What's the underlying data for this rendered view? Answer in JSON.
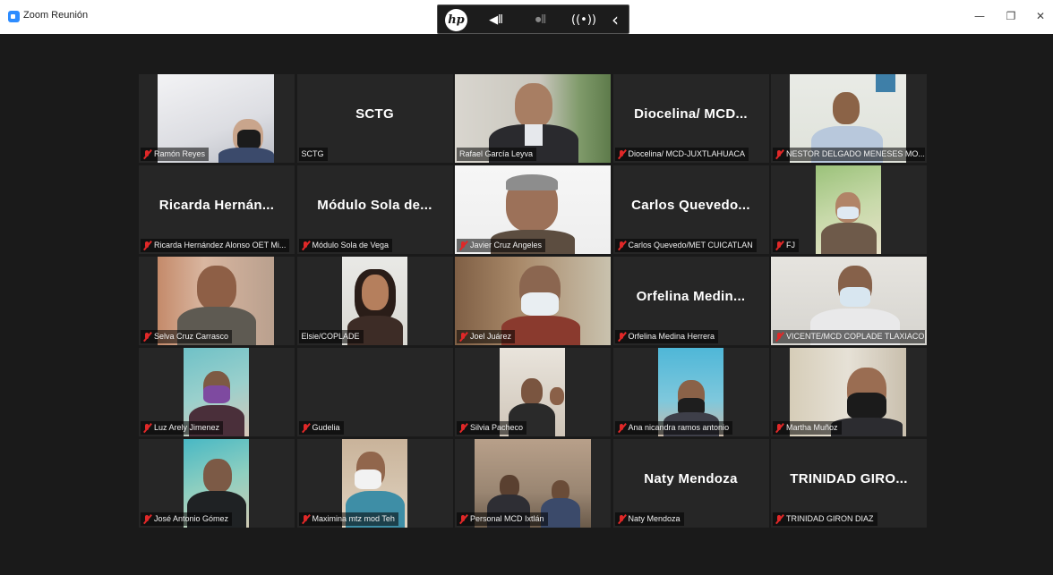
{
  "window": {
    "title": "Zoom Reunión",
    "minimize": "—",
    "restore": "❐",
    "close": "✕"
  },
  "hp_toolbar": {
    "logo": "hp",
    "speaker": "◀⦀",
    "mic": "⏺⦀",
    "broadcast": "((•))",
    "collapse": "‹"
  },
  "colors": {
    "active_speaker_border": "#a6cc3b",
    "muted_icon": "#e02828",
    "tile_bg": "#262626"
  },
  "participants": [
    {
      "label": "Ramón Reyes",
      "muted": true,
      "video": true
    },
    {
      "label": "SCTG",
      "display": "SCTG",
      "muted": false,
      "video": false
    },
    {
      "label": "Rafael García Leyva",
      "muted": false,
      "video": true,
      "active": true
    },
    {
      "label": "Diocelina/ MCD-JUXTLAHUACA",
      "display": "Diocelina/ MCD...",
      "muted": true,
      "video": false
    },
    {
      "label": "NESTOR DELGADO MENESES MO...",
      "muted": true,
      "video": true
    },
    {
      "label": "Ricarda Hernández Alonso OET Mi...",
      "display": "Ricarda Hernán...",
      "muted": true,
      "video": false
    },
    {
      "label": "Módulo Sola de Vega",
      "display": "Módulo Sola de...",
      "muted": true,
      "video": false
    },
    {
      "label": "Javier Cruz Angeles",
      "muted": true,
      "video": true
    },
    {
      "label": "Carlos Quevedo/MET CUICATLAN",
      "display": "Carlos Quevedo...",
      "muted": true,
      "video": false
    },
    {
      "label": "FJ",
      "muted": true,
      "video": true
    },
    {
      "label": "Selva Cruz Carrasco",
      "muted": true,
      "video": true
    },
    {
      "label": "Elsie/COPLADE",
      "muted": false,
      "video": true
    },
    {
      "label": "Joel Juárez",
      "muted": true,
      "video": true
    },
    {
      "label": "Orfelina Medina Herrera",
      "display": "Orfelina Medin...",
      "muted": true,
      "video": false
    },
    {
      "label": "VICENTE/MCD COPLADE TLAXIACO",
      "muted": true,
      "video": true
    },
    {
      "label": "Luz Arely Jimenez",
      "muted": true,
      "video": true
    },
    {
      "label": "Gudelia",
      "muted": true,
      "video": false
    },
    {
      "label": "Silvia Pacheco",
      "muted": true,
      "video": true
    },
    {
      "label": "Ana nicandra ramos antonio",
      "muted": true,
      "video": true
    },
    {
      "label": "Martha Muñoz",
      "muted": true,
      "video": true
    },
    {
      "label": "José Antonio Gómez",
      "muted": true,
      "video": true
    },
    {
      "label": "Maximina mtz mod Teh",
      "muted": true,
      "video": true
    },
    {
      "label": "Personal MCD Ixtlán",
      "muted": true,
      "video": true
    },
    {
      "label": "Naty Mendoza",
      "display": "Naty Mendoza",
      "muted": true,
      "video": false
    },
    {
      "label": "TRINIDAD GIRON DIAZ",
      "display": "TRINIDAD GIRO...",
      "muted": true,
      "video": false
    }
  ]
}
